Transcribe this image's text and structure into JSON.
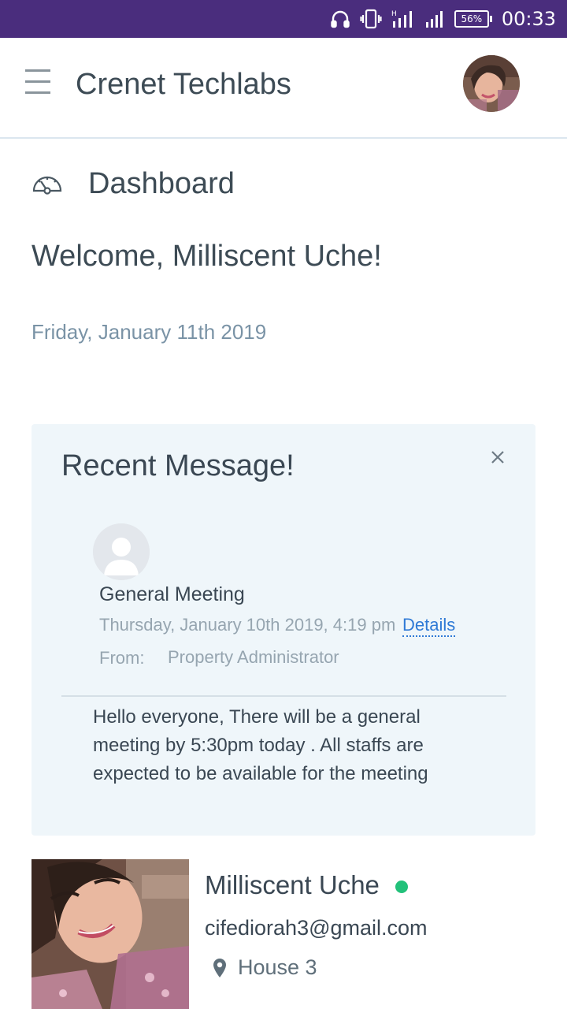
{
  "status_bar": {
    "battery_percent": "56%",
    "time": "00:33",
    "icons": [
      "headset-icon",
      "vibrate-icon",
      "signal-icon",
      "signal-icon",
      "battery-icon"
    ]
  },
  "header": {
    "title": "Crenet Techlabs",
    "menu_icon": "hamburger-icon"
  },
  "dashboard": {
    "icon": "dashboard-gauge-icon",
    "label": "Dashboard"
  },
  "welcome": {
    "text": "Welcome, Milliscent Uche!",
    "date": "Friday, January 11th 2019"
  },
  "recent_message": {
    "title": "Recent Message!",
    "subject": "General Meeting",
    "timestamp": "Thursday, January 10th 2019, 4:19 pm",
    "details_link": "Details",
    "from_label": "From:",
    "from_value": "Property Administrator",
    "body": "Hello everyone, There will be a general meeting by 5:30pm today . All staffs are expected to be available for the meeting"
  },
  "profile": {
    "name": "Milliscent Uche",
    "email": "cifediorah3@gmail.com",
    "location": "House 3",
    "status_color": "#22c17a"
  },
  "colors": {
    "status_bar": "#4a2d7d",
    "card_bg": "#eff6fa",
    "link": "#2f7ad6",
    "text": "#3a4753"
  }
}
